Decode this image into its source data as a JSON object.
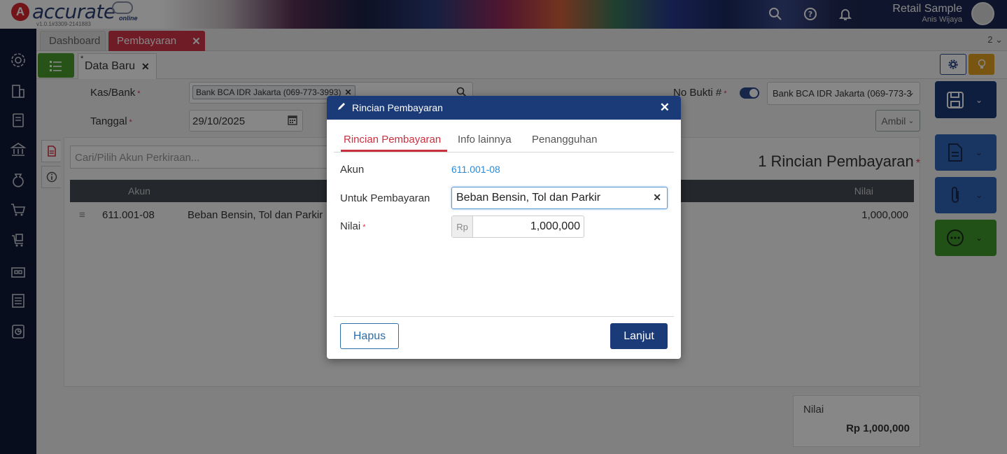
{
  "header": {
    "logo_text": "accurate",
    "logo_sub": "online",
    "version": "v1.0.1#3309-2141883",
    "company": "Retail Sample",
    "user": "Anis Wijaya"
  },
  "module_tabs": {
    "dashboard": "Dashboard",
    "pembayaran": "Pembayaran",
    "count": "2"
  },
  "sub_tab": {
    "star": "*",
    "label": "Data Baru"
  },
  "form": {
    "kas_bank_label": "Kas/Bank",
    "kas_bank_value": "Bank BCA IDR Jakarta (069-773-3993)",
    "tanggal_label": "Tanggal",
    "tanggal_value": "29/10/2025",
    "no_bukti_label": "No Bukti #",
    "no_bukti_bank": "Bank BCA IDR Jakarta (069-773-3",
    "ambil_label": "Ambil",
    "required_mark": "*"
  },
  "detail": {
    "search_placeholder": "Cari/Pilih Akun Perkiraan...",
    "rincian_count": "1 Rincian Pembayaran",
    "columns": {
      "akun": "Akun",
      "nilai": "Nilai"
    },
    "rows": [
      {
        "akun": "611.001-08",
        "nama": "Beban Bensin, Tol dan Parkir",
        "nilai": "1,000,000"
      }
    ]
  },
  "total": {
    "label": "Nilai",
    "value": "Rp 1,000,000"
  },
  "modal": {
    "title": "Rincian Pembayaran",
    "tabs": [
      "Rincian Pembayaran",
      "Info lainnya",
      "Penangguhan"
    ],
    "akun_label": "Akun",
    "akun_value": "611.001-08",
    "untuk_label": "Untuk Pembayaran",
    "untuk_value": "Beban Bensin, Tol dan Parkir",
    "nilai_label": "Nilai",
    "nilai_prefix": "Rp",
    "nilai_value": "1,000,000",
    "hapus_label": "Hapus",
    "lanjut_label": "Lanjut"
  },
  "colors": {
    "brand_navy": "#1a3a78",
    "accent_red": "#c9313f",
    "link_blue": "#2b8ad6",
    "green": "#4a9e2f",
    "orange": "#e3a220"
  }
}
